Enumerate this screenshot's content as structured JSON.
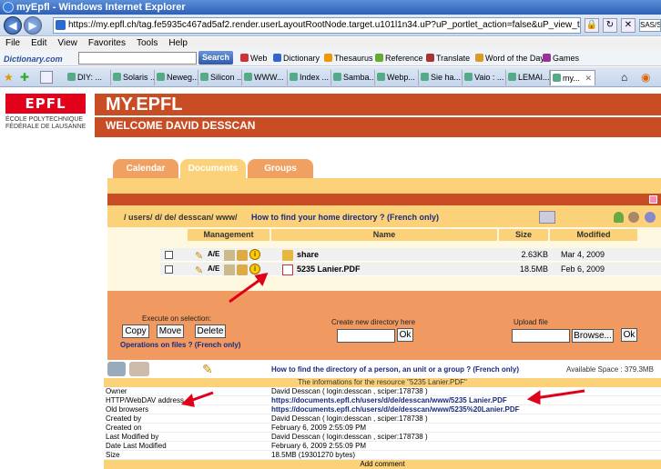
{
  "window": {
    "title": "myEpfl - Windows Internet Explorer"
  },
  "address": {
    "url": "https://my.epfl.ch/tag.fe5935c467ad5af2.render.userLayoutRootNode.target.u101l1n34.uP?uP_portlet_action=false&uP_view_target=u101l1n34&currentWorkingDir=%",
    "right_text": "SAS/S"
  },
  "menu": [
    "File",
    "Edit",
    "View",
    "Favorites",
    "Tools",
    "Help"
  ],
  "dictbar": {
    "logo": "Dictionary.com",
    "search_label": "Search",
    "links": [
      "Web",
      "Dictionary",
      "Thesaurus",
      "Reference",
      "Translate",
      "Word of the Day",
      "Games"
    ]
  },
  "tabs": [
    "DIY: ...",
    "Solaris ...",
    "Neweg...",
    "Silicon ...",
    "WWW...",
    "Index ...",
    "Samba...",
    "Webp...",
    "Sie ha...",
    "Vaio : ...",
    "LEMAI...",
    "my..."
  ],
  "brand": {
    "logo": "EPFL",
    "subtitle_1": "ÉCOLE POLYTECHNIQUE",
    "subtitle_2": "FÉDÉRALE DE LAUSANNE"
  },
  "header": {
    "title": "MY.EPFL",
    "welcome": "WELCOME DAVID DESSCAN"
  },
  "portal_tabs": [
    "Calendar",
    "Documents",
    "Groups"
  ],
  "path": {
    "current": "/ users/ d/ de/ desscan/ www/",
    "help_link": "How to find your home directory ? (French only)"
  },
  "table": {
    "headers": {
      "management": "Management",
      "name": "Name",
      "size": "Size",
      "modified": "Modified"
    },
    "rows": [
      {
        "name": "share",
        "size": "2.63KB",
        "modified": "Mar 4, 2009"
      },
      {
        "name": "5235 Lanier.PDF",
        "size": "18.5MB",
        "modified": "Feb 6, 2009"
      }
    ]
  },
  "ops": {
    "execute_label": "Execute on selection:",
    "copy": "Copy",
    "move": "Move",
    "delete": "Delete",
    "ops_help": "Operations on files ? (French only)",
    "create_dir_label": "Create new directory here",
    "ok": "Ok",
    "upload_label": "Upload file",
    "browse": "Browse..."
  },
  "help": {
    "find_link": "How to find the directory of a person, an unit or a group ? (French only)",
    "space": "Available Space : 379.3MB"
  },
  "info": {
    "caption": "The informations for the resource \"5235 Lanier.PDF\"",
    "rows": [
      {
        "k": "Owner",
        "v": "David Desscan ( login:desscan , sciper:178738 )"
      },
      {
        "k": "HTTP/WebDAV address",
        "v": "https://documents.epfl.ch/users/d/de/desscan/www/5235 Lanier.PDF"
      },
      {
        "k": "Old browsers",
        "v": "https://documents.epfl.ch/users/d/de/desscan/www/5235%20Lanier.PDF"
      },
      {
        "k": "Created by",
        "v": "David Desscan ( login:desscan , sciper:178738 )"
      },
      {
        "k": "Created on",
        "v": "February 6, 2009 2:55:09 PM"
      },
      {
        "k": "Last Modified by",
        "v": "David Desscan ( login:desscan , sciper:178738 )"
      },
      {
        "k": "Date Last Modified",
        "v": "February 6, 2009 2:55:09 PM"
      },
      {
        "k": "Size",
        "v": "18.5MB (19301270 bytes)"
      }
    ],
    "add_comment": "Add comment"
  },
  "colors": {
    "epfl_red": "#e2001a",
    "header": "#c94d24",
    "tab": "#f0a060",
    "frame": "#fbd27a",
    "ops": "#f09a62",
    "arrow": "#e0001a"
  }
}
